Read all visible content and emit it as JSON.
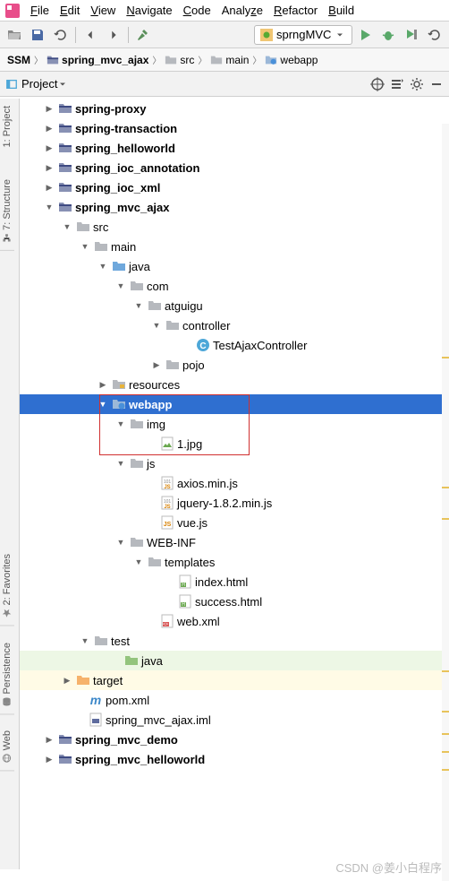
{
  "menubar": {
    "file": "File",
    "edit": "Edit",
    "view": "View",
    "navigate": "Navigate",
    "code": "Code",
    "analyze": "Analyze",
    "refactor": "Refactor",
    "build": "Build"
  },
  "run_config": "sprngMVC",
  "breadcrumb": {
    "root": "SSM",
    "b1": "spring_mvc_ajax",
    "b2": "src",
    "b3": "main",
    "b4": "webapp"
  },
  "project_panel": {
    "title": "Project"
  },
  "side": {
    "project": "1: Project",
    "structure": "7: Structure",
    "favorites": "2: Favorites",
    "persistence": "Persistence",
    "web": "Web"
  },
  "tree": {
    "spring_proxy": "spring-proxy",
    "spring_transaction": "spring-transaction",
    "spring_helloworld": "spring_helloworld",
    "spring_ioc_annotation": "spring_ioc_annotation",
    "spring_ioc_xml": "spring_ioc_xml",
    "spring_mvc_ajax": "spring_mvc_ajax",
    "src": "src",
    "main": "main",
    "java": "java",
    "com": "com",
    "atguigu": "atguigu",
    "controller": "controller",
    "test_ajax_controller": "TestAjaxController",
    "pojo": "pojo",
    "resources": "resources",
    "webapp": "webapp",
    "img": "img",
    "one_jpg": "1.jpg",
    "js": "js",
    "axios": "axios.min.js",
    "jquery": "jquery-1.8.2.min.js",
    "vue": "vue.js",
    "web_inf": "WEB-INF",
    "templates": "templates",
    "index_html": "index.html",
    "success_html": "success.html",
    "web_xml": "web.xml",
    "test": "test",
    "test_java": "java",
    "target": "target",
    "pom_xml": "pom.xml",
    "iml": "spring_mvc_ajax.iml",
    "spring_mvc_demo": "spring_mvc_demo",
    "spring_mvc_helloworld": "spring_mvc_helloworld"
  },
  "watermark": "CSDN @姜小白程序"
}
